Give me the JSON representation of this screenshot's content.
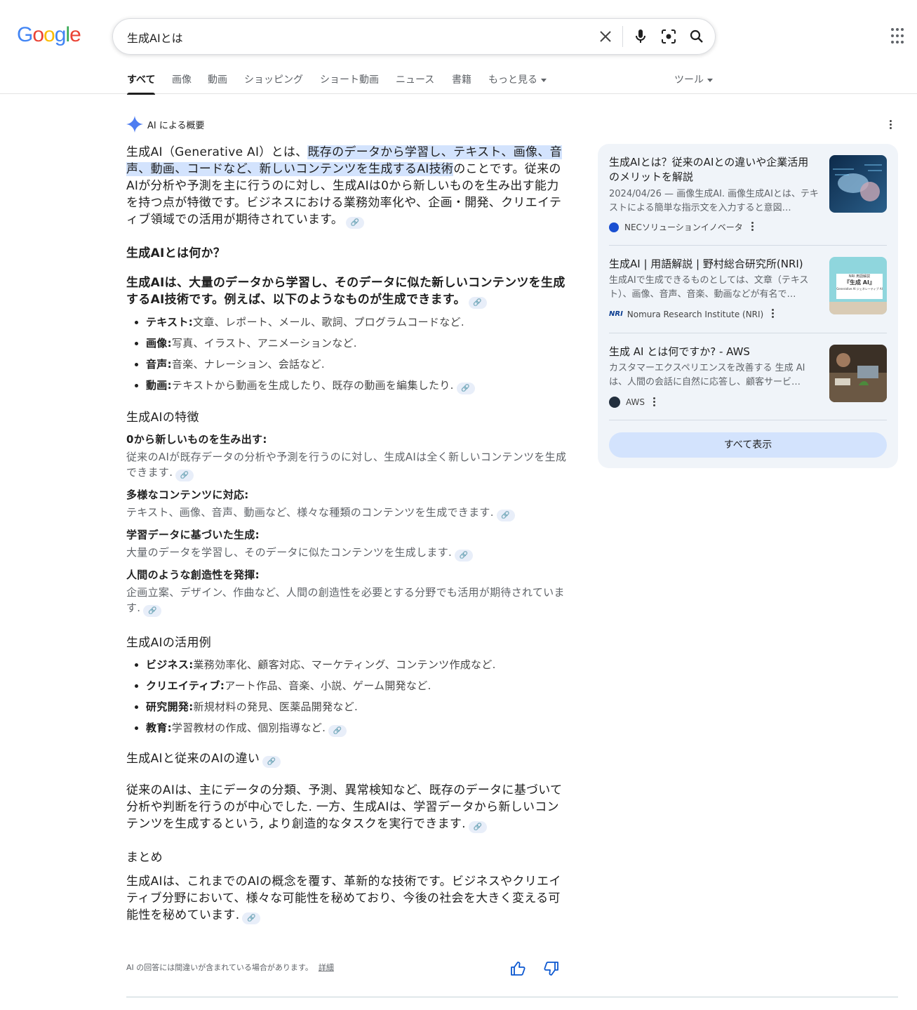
{
  "logo": {
    "G": "G",
    "o1": "o",
    "o2": "o",
    "g": "g",
    "l": "l",
    "e": "e"
  },
  "search": {
    "query": "生成AIとは"
  },
  "tabs": [
    {
      "label": "すべて"
    },
    {
      "label": "画像"
    },
    {
      "label": "動画"
    },
    {
      "label": "ショッピング"
    },
    {
      "label": "ショート動画"
    },
    {
      "label": "ニュース"
    },
    {
      "label": "書籍"
    },
    {
      "label": "もっと見る"
    }
  ],
  "tools_label": "ツール",
  "ai": {
    "label": "AI による概要",
    "intro_pre": "生成AI（Generative AI）とは、",
    "intro_hl": "既存のデータから学習し、テキスト、画像、音声、動画、コードなど、新しいコンテンツを生成するAI技術",
    "intro_post": "のことです。従来のAIが分析や予測を主に行うのに対し、生成AIは0から新しいものを生み出す能力を持つ点が特徴です。ビジネスにおける業務効率化や、企画・開発、クリエイティブ領域での活用が期待されています。",
    "q_heading": "生成AIとは何か？",
    "q_body": "生成AIは、大量のデータから学習し、そのデータに似た新しいコンテンツを生成するAI技術です。例えば、以下のようなものが生成できます。",
    "gen_items": [
      {
        "term": "テキスト:",
        "desc": "文章、レポート、メール、歌詞、プログラムコードなど."
      },
      {
        "term": "画像:",
        "desc": "写真、イラスト、アニメーションなど."
      },
      {
        "term": "音声:",
        "desc": "音楽、ナレーション、会話など."
      },
      {
        "term": "動画:",
        "desc": "テキストから動画を生成したり、既存の動画を編集したり."
      }
    ],
    "features_heading": "生成AIの特徴",
    "features": [
      {
        "title": "0から新しいものを生み出す:",
        "desc": "従来のAIが既存データの分析や予測を行うのに対し、生成AIは全く新しいコンテンツを生成できます."
      },
      {
        "title": "多様なコンテンツに対応:",
        "desc": "テキスト、画像、音声、動画など、様々な種類のコンテンツを生成できます."
      },
      {
        "title": "学習データに基づいた生成:",
        "desc": "大量のデータを学習し、そのデータに似たコンテンツを生成します."
      },
      {
        "title": "人間のような創造性を発揮:",
        "desc": "企画立案、デザイン、作曲など、人間の創造性を必要とする分野でも活用が期待されています."
      }
    ],
    "uses_heading": "生成AIの活用例",
    "uses": [
      {
        "term": "ビジネス:",
        "desc": "業務効率化、顧客対応、マーケティング、コンテンツ作成など."
      },
      {
        "term": "クリエイティブ:",
        "desc": "アート作品、音楽、小説、ゲーム開発など."
      },
      {
        "term": "研究開発:",
        "desc": "新規材料の発見、医薬品開発など."
      },
      {
        "term": "教育:",
        "desc": "学習教材の作成、個別指導など."
      }
    ],
    "diff_heading": "生成AIと従来のAIの違い",
    "diff_body": "従来のAIは、主にデータの分類、予測、異常検知など、既存のデータに基づいて分析や判断を行うのが中心でした. 一方、生成AIは、学習データから新しいコンテンツを生成するという, より創造的なタスクを実行できます.",
    "summary_heading": "まとめ",
    "summary_body": "生成AIは、これまでのAIの概念を覆す、革新的な技術です。ビジネスやクリエイティブ分野において、様々な可能性を秘めており、今後の社会を大きく変える可能性を秘めています.",
    "disclaimer": "AI の回答には間違いが含まれている場合があります。",
    "details_link": "詳細"
  },
  "sources": [
    {
      "title": "生成AIとは？従来のAIとの違いや企業活用のメリットを解説",
      "snippet": "2024/04/26 — 画像生成AI. 画像生成AIとは、テキストによる簡単な指示文を入力すると意図…",
      "source": "NECソリューションイノベータ",
      "favicon_color": "#1a4fd1"
    },
    {
      "title": "生成AI | 用語解説 | 野村総合研究所(NRI)",
      "snippet": "生成AIで生成できるものとしては、文章（テキスト）、画像、音声、音楽、動画などが有名で…",
      "source": "Nomura Research Institute (NRI)",
      "favicon_color": "#0b3d91",
      "thumb_text_top": "NRI 用語解説",
      "thumb_text_main": "『生成 AI』",
      "thumb_text_sub": "Generative AI ジェネレーティブ AI"
    },
    {
      "title": "生成 AI とは何ですか? - AWS",
      "snippet": "カスタマーエクスペリエンスを改善する 生成 AI は、人間の会話に自然に応答し、顧客サービ…",
      "source": "AWS",
      "favicon_color": "#232f3e"
    }
  ],
  "show_all": "すべて表示"
}
